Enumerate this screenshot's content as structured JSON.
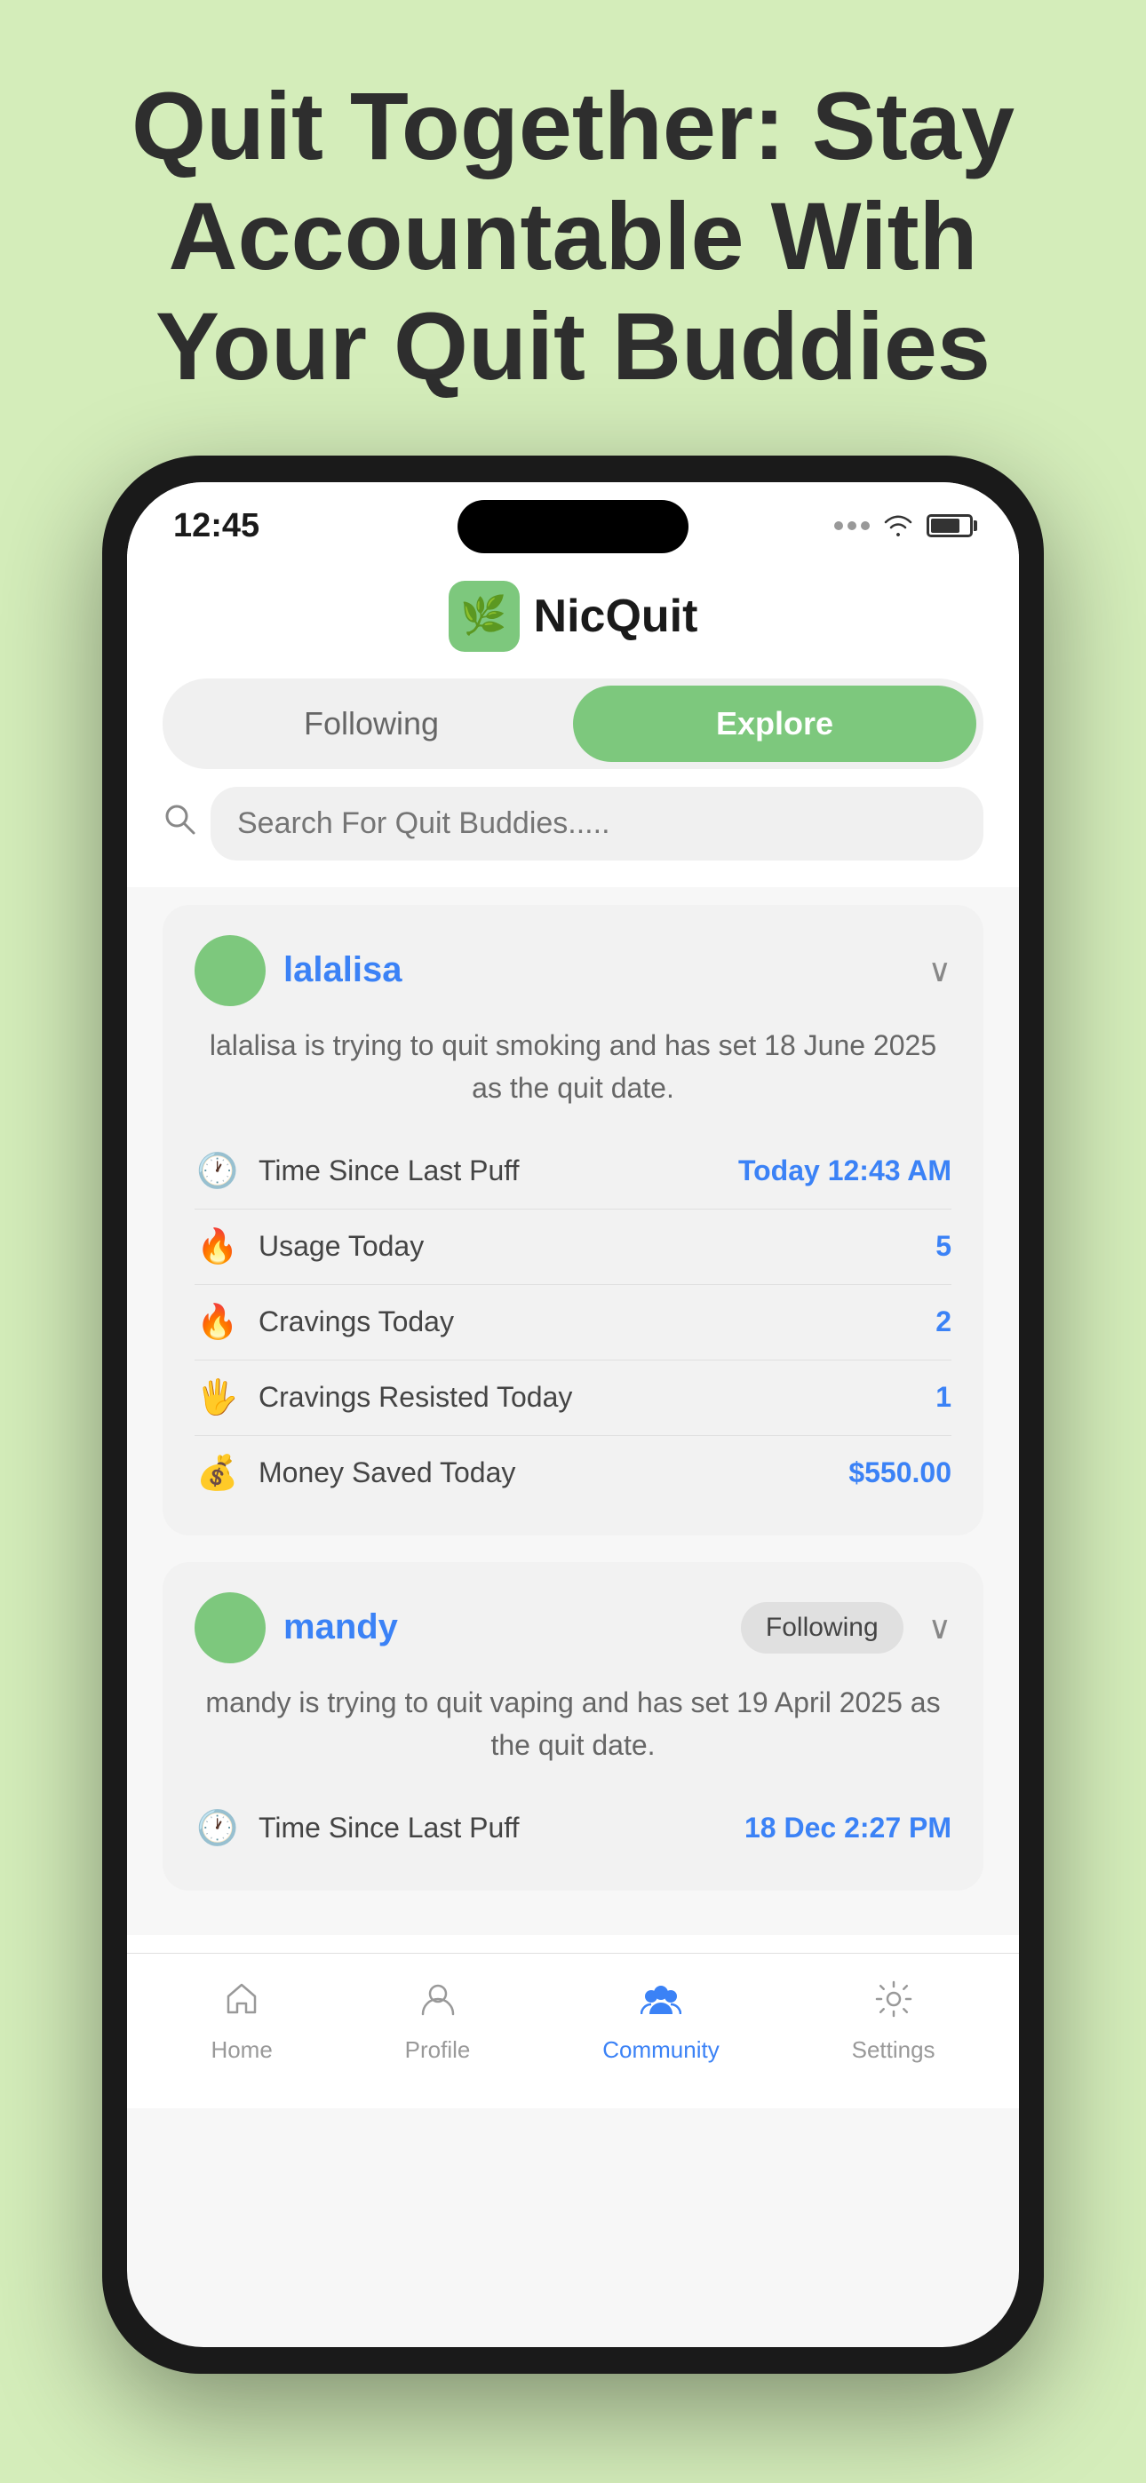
{
  "hero": {
    "title": "Quit Together: Stay Accountable With Your Quit Buddies"
  },
  "statusBar": {
    "time": "12:45",
    "dots": 3,
    "wifi": "wifi",
    "battery": "battery"
  },
  "appHeader": {
    "icon": "🌿",
    "name": "NicQuit"
  },
  "tabs": {
    "following": "Following",
    "explore": "Explore",
    "activeTab": "explore"
  },
  "search": {
    "placeholder": "Search For Quit Buddies....."
  },
  "users": [
    {
      "id": "lalalisa",
      "username": "lalalisa",
      "showFollowing": false,
      "description": "lalalisa is trying to quit smoking and has set 18 June 2025 as the quit date.",
      "stats": [
        {
          "emoji": "🕐",
          "label": "Time Since Last Puff",
          "value": "Today 12:43 AM",
          "valueColor": "blue"
        },
        {
          "emoji": "🔥",
          "label": "Usage Today",
          "value": "5",
          "valueColor": "blue"
        },
        {
          "emoji": "🔥",
          "label": "Cravings Today",
          "value": "2",
          "valueColor": "blue"
        },
        {
          "emoji": "🖐️",
          "label": "Cravings Resisted Today",
          "value": "1",
          "valueColor": "blue"
        },
        {
          "emoji": "💰",
          "label": "Money Saved Today",
          "value": "$550.00",
          "valueColor": "blue"
        }
      ]
    },
    {
      "id": "mandy",
      "username": "mandy",
      "showFollowing": true,
      "followingLabel": "Following",
      "description": "mandy is trying to quit vaping and has set 19 April 2025 as the quit date.",
      "stats": [
        {
          "emoji": "🕐",
          "label": "Time Since Last Puff",
          "value": "18 Dec 2:27 PM",
          "valueColor": "blue"
        }
      ]
    }
  ],
  "bottomNav": [
    {
      "icon": "home",
      "label": "Home",
      "active": false
    },
    {
      "icon": "person",
      "label": "Profile",
      "active": false
    },
    {
      "icon": "community",
      "label": "Community",
      "active": true
    },
    {
      "icon": "settings",
      "label": "Settings",
      "active": false
    }
  ]
}
